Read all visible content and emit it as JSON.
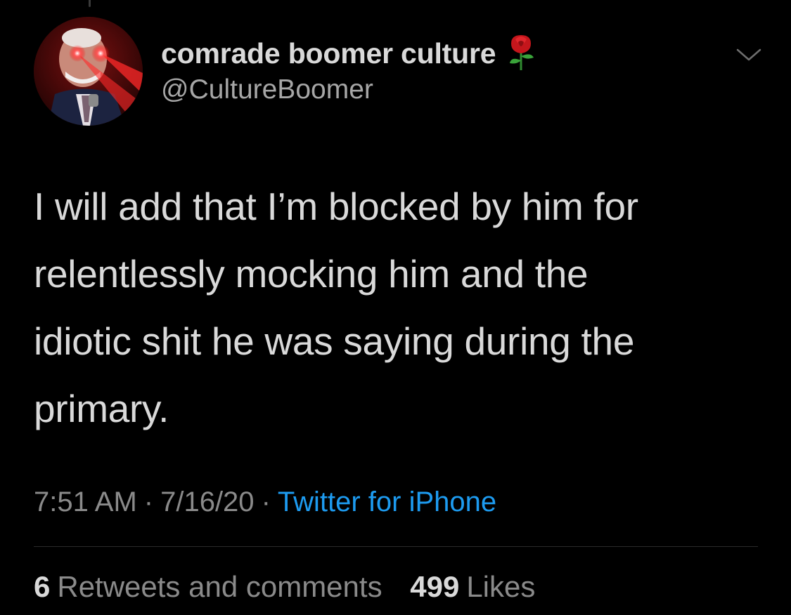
{
  "tweet": {
    "author": {
      "display_name": "comrade boomer culture",
      "handle": "@CultureBoomer",
      "badge_icon": "rose-icon"
    },
    "text_lines": [
      "I will add that I’m blocked by him for",
      "relentlessly mocking him and the",
      "idiotic shit he was saying during the",
      "primary."
    ],
    "time": "7:51 AM",
    "date": "7/16/20",
    "separator": "·",
    "source": "Twitter for iPhone",
    "stats": {
      "retweets_count": "6",
      "retweets_label": "Retweets and comments",
      "likes_count": "499",
      "likes_label": "Likes"
    }
  },
  "colors": {
    "background": "#000000",
    "text": "#d9d9d9",
    "secondary_text": "#8a8a8a",
    "link": "#1d9bf0",
    "divider": "#2b2b2b"
  },
  "icons": {
    "menu": "chevron-down-icon",
    "avatar": "avatar"
  }
}
